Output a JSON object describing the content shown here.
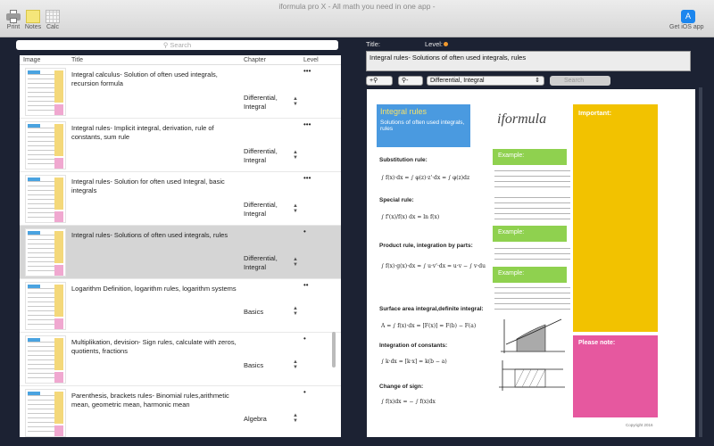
{
  "window": {
    "title": "iformula pro X - All math you need in one app -"
  },
  "toolbar": {
    "print_label": "Print",
    "notes_label": "Notes",
    "calc_label": "Calc",
    "ios_label": "Get iOS app"
  },
  "search": {
    "placeholder": "Search"
  },
  "list": {
    "columns": {
      "image": "Image",
      "title": "Title",
      "chapter": "Chapter",
      "level": "Level"
    },
    "rows": [
      {
        "title": "Integral calculus- Solution of often used integrals, recursion formula",
        "chapter": "Differential, Integral",
        "level": "•••"
      },
      {
        "title": "Integral rules- Implicit integral, derivation, rule of constants, sum rule",
        "chapter": "Differential, Integral",
        "level": "•••"
      },
      {
        "title": "Integral rules- Solution for often used Integral, basic integrals",
        "chapter": "Differential, Integral",
        "level": "•••"
      },
      {
        "title": "Integral rules- Solutions of often used integrals, rules",
        "chapter": "Differential, Integral",
        "level": "•"
      },
      {
        "title": "Logarithm Definition, logarithm rules, logarithm systems",
        "chapter": "Basics",
        "level": "••"
      },
      {
        "title": "Multiplikation, devision- Sign rules, calculate with zeros, quotients, fractions",
        "chapter": "Basics",
        "level": "•"
      },
      {
        "title": "Parenthesis, brackets rules- Binomial rules,arithmetic mean, geometric mean, harmonic mean",
        "chapter": "Algebra",
        "level": "•"
      }
    ]
  },
  "detail": {
    "title_label": "Title:",
    "level_label": "Level:",
    "level_color": "#f29a2e",
    "title_value": "Integral rules- Solutions of often used integrals, rules",
    "zoom_in_label": "+",
    "zoom_out_label": "-",
    "chapter_select": "Differential, Integral",
    "preview_search_placeholder": "Search"
  },
  "document": {
    "header_title": "Integral rules",
    "header_subtitle": "Solutions of often used integrals, rules",
    "logo": "iformula",
    "sections": {
      "substitution": "Substitution rule:",
      "special": "Special rule:",
      "product": "Product rule, integration by parts:",
      "surface": "Surface area integral,definite integral:",
      "constants": "Integration of constants:",
      "sign": "Change of sign:"
    },
    "formulas": {
      "substitution": "∫ f(x)·dx = ∫ φ(z)·z'·dx = ∫ φ(z)dz",
      "special": "∫ f'(x)/f(x) dx = ln f(x)",
      "product": "∫ f(x)·g(x)·dx = ∫ u·v'·dx = u·v − ∫ v·du",
      "surface": "A = ∫ f(x)·dx = [F(x)] = F(b) − F(a)",
      "constants": "∫ k·dx = [k·x] = k(b − a)",
      "sign": "∫ f(x)dx = − ∫ f(x)dx"
    },
    "example_label": "Example:",
    "important_label": "Important:",
    "note_label": "Please note:",
    "copyright": "Copyright 2016",
    "colors": {
      "blue": "#4a9ae0",
      "green": "#8fd14f",
      "yellow": "#f2c200",
      "pink": "#e6589f"
    }
  }
}
